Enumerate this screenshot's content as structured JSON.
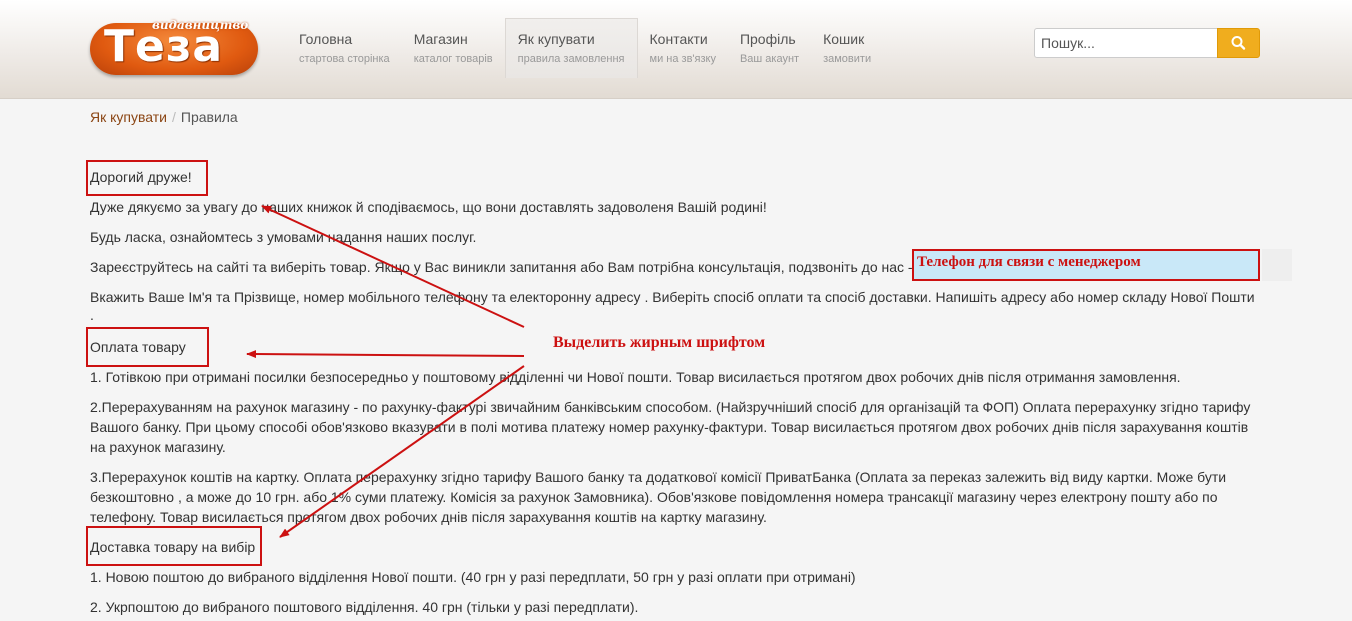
{
  "header": {
    "logo_text": "Теза",
    "logo_sub": "видавництво",
    "nav": [
      {
        "title": "Головна",
        "sub": "стартова сторінка"
      },
      {
        "title": "Магазин",
        "sub": "каталог товарів"
      },
      {
        "title": "Як купувати",
        "sub": "правила замовлення"
      },
      {
        "title": "Контакти",
        "sub": "ми на зв'язку"
      },
      {
        "title": "Профіль",
        "sub": "Ваш акаунт"
      },
      {
        "title": "Кошик",
        "sub": "замовити"
      }
    ],
    "search_placeholder": "Пошук...",
    "accent": "#f0ad1e",
    "search_icon": "search-icon"
  },
  "breadcrumb": {
    "link": "Як купувати",
    "separator": "/",
    "current": "Правила"
  },
  "content": {
    "greeting": "Дорогий друже!",
    "p1": "Дуже дякуємо за увагу до наших книжок й сподіваємось, що вони доставлять задоволеня Вашій родині!",
    "p2": "Будь ласка, ознайомтесь з умовами надання наших послуг.",
    "p3": "Зареєструйтесь на сайті та виберіть товар. Якщо у Вас виникли запитання або Вам потрібна консультація, подзвоніть до нас -",
    "p4": "Вкажить Ваше Ім'я та Прізвище, номер мобільного телефону та електоронну адресу . Виберіть спосіб оплати та спосіб доставки. Напишіть адресу або номер складу Нової Пошти",
    "p4_tail": ".",
    "payment_heading": "Оплата товару",
    "pay1": "1. Готівкою при отримані посилки безпосередньо у поштовому відділенні чи Нової пошти. Товар висилається протягом двох робочих днів після отримання замовлення.",
    "pay2_l1": "2.Перерахуванням на рахунок магазину - по рахунку-фактурі звичайним банківським способом. (Найзручніший спосіб для організацій та ФОП) Оплата перерахунку згідно тарифу",
    "pay2_l2": "Вашого банку. При цьому способі обов'язково вказувати в полі мотива платежу номер  рахунку-фактури. Товар висилається протягом двох робочих днів після зарахування коштів",
    "pay2_l3": "на рахунок магазину.",
    "pay3_l1": "3.Перерахунок коштів на картку. Оплата перерахунку згідно тарифу Вашого банку та додаткової комісії ПриватБанка (Оплата за переказ залежить від виду картки. Може бути",
    "pay3_l2": "безкоштовно , а може до 10 грн. або 1% суми платежу. Комісія за рахунок Замовника). Обов'язкове повідомлення номера трансакції магазину через електрону пошту або по",
    "pay3_l3": "телефону. Товар висилається протягом двох робочих днів після зарахування коштів на картку магазину.",
    "delivery_heading": "Доставка товару на вибір",
    "del1": "1. Новою поштою до вибраного відділення Нової пошти. (40 грн у разі передплати, 50 грн у разі оплати при отримані)",
    "del2": "2. Укрпоштою до вибраного поштового відділення. 40 грн (тільки у разі передплати)."
  },
  "annotations": {
    "phone_note": "Телефон для связи с менеджером",
    "bold_note": "Выделить жирным шрифтом",
    "color": "#cc1111"
  }
}
